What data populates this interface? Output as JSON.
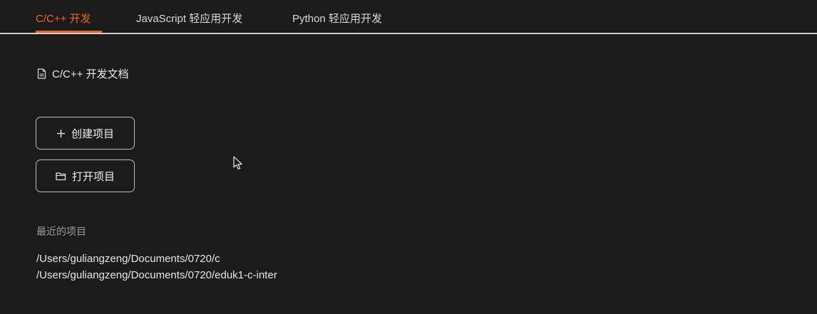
{
  "tabs": [
    {
      "label": "C/C++ 开发",
      "active": true
    },
    {
      "label": "JavaScript 轻应用开发",
      "active": false
    },
    {
      "label": "Python 轻应用开发",
      "active": false
    }
  ],
  "doc_link": {
    "label": "C/C++ 开发文档",
    "icon": "document-icon"
  },
  "buttons": {
    "create": {
      "label": "创建项目",
      "icon": "plus-icon"
    },
    "open": {
      "label": "打开项目",
      "icon": "folder-icon"
    }
  },
  "recent": {
    "title": "最近的项目",
    "items": [
      "/Users/guliangzeng/Documents/0720/c",
      "/Users/guliangzeng/Documents/0720/eduk1-c-inter"
    ]
  },
  "colors": {
    "accent": "#e9651f",
    "background": "#1b1b1b"
  }
}
